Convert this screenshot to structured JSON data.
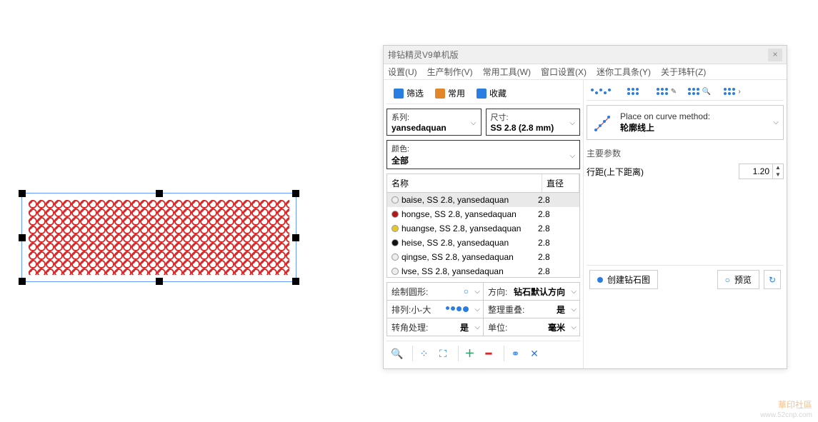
{
  "window": {
    "title": "排钻精灵V9单机版"
  },
  "menu": [
    "设置(U)",
    "生产制作(V)",
    "常用工具(W)",
    "窗口设置(X)",
    "迷你工具条(Y)",
    "关于玮轩(Z)"
  ],
  "tabs": {
    "filter": "筛选",
    "common": "常用",
    "favorite": "收藏"
  },
  "fields": {
    "series_label": "系列:",
    "series_value": "yansedaquan",
    "size_label": "尺寸:",
    "size_value": "SS 2.8 (2.8 mm)",
    "color_label": "颜色:",
    "color_value": "全部"
  },
  "list": {
    "head_name": "名称",
    "head_diam": "直径",
    "rows": [
      {
        "color": "#eeeeee",
        "name": "baise, SS 2.8, yansedaquan",
        "diam": "2.8"
      },
      {
        "color": "#b01818",
        "name": "hongse, SS 2.8, yansedaquan",
        "diam": "2.8"
      },
      {
        "color": "#e3c72a",
        "name": "huangse, SS 2.8, yansedaquan",
        "diam": "2.8"
      },
      {
        "color": "#111111",
        "name": "heise, SS 2.8, yansedaquan",
        "diam": "2.8"
      },
      {
        "color": "#eeeeee",
        "name": "qingse, SS 2.8, yansedaquan",
        "diam": "2.8"
      },
      {
        "color": "#eeeeee",
        "name": "lvse, SS 2.8, yansedaquan",
        "diam": "2.8"
      }
    ]
  },
  "options": {
    "draw_shape": "绘制圆形:",
    "direction_lbl": "方向:",
    "direction_val": "钻石默认方向",
    "arrange_lbl": "排列:小-大",
    "reorg_lbl": "整理重叠:",
    "reorg_val": "是",
    "corner_lbl": "转角处理:",
    "corner_val": "是",
    "unit_lbl": "单位:",
    "unit_val": "毫米"
  },
  "right": {
    "method_title": "Place on curve method:",
    "method_value": "轮廓线上",
    "params_title": "主要参数",
    "row_spacing_lbl": "行距(上下距离)",
    "row_spacing_val": "1.20",
    "create_btn": "创建钻石图",
    "preview_btn": "预览"
  },
  "watermark": {
    "main": "華印社區",
    "sub": "www.52cnp.com"
  }
}
